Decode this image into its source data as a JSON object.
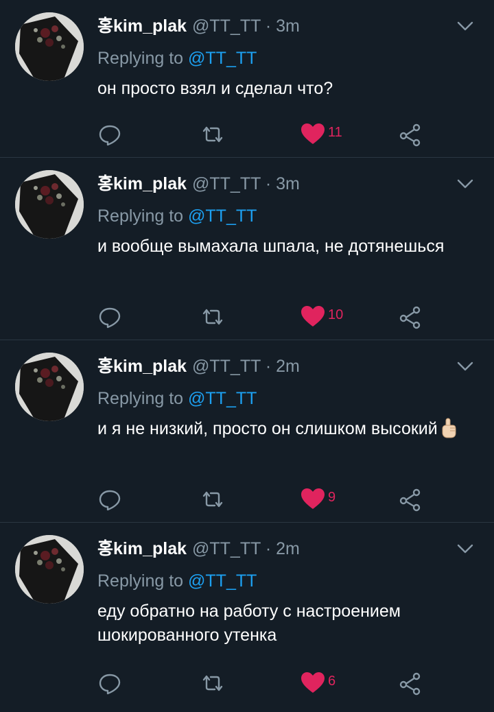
{
  "colors": {
    "background": "#141d26",
    "divider": "#2b3742",
    "text": "#ffffff",
    "muted": "#8899a6",
    "link": "#1da1f2",
    "like": "#e0245e"
  },
  "icons": {
    "menu": "chevron-down-icon",
    "reply": "reply-icon",
    "retweet": "retweet-icon",
    "like": "heart-icon",
    "share": "share-icon"
  },
  "tweets": [
    {
      "display_name": "홍kim_plak",
      "meta": "@TT_TT · 3m",
      "replying_prefix": "Replying to ",
      "replying_handle": "@TT_TT",
      "text": "он просто взял и сделал что?",
      "emoji": "",
      "likes": "11",
      "liked": true
    },
    {
      "display_name": "홍kim_plak",
      "meta": "@TT_TT · 3m",
      "replying_prefix": "Replying to ",
      "replying_handle": "@TT_TT",
      "text": "и вообще вымахала шпала, не дотянешься",
      "emoji": "",
      "likes": "10",
      "liked": true
    },
    {
      "display_name": "홍kim_plak",
      "meta": "@TT_TT · 2m",
      "replying_prefix": "Replying to ",
      "replying_handle": "@TT_TT",
      "text": "и я не низкий, просто он слишком высокий",
      "emoji": "pointing-up-hand-emoji",
      "likes": "9",
      "liked": true
    },
    {
      "display_name": "홍kim_plak",
      "meta": "@TT_TT · 2m",
      "replying_prefix": "Replying to ",
      "replying_handle": "@TT_TT",
      "text": "еду обратно на работу с настроением шокированного утенка",
      "emoji": "",
      "likes": "6",
      "liked": true
    }
  ]
}
